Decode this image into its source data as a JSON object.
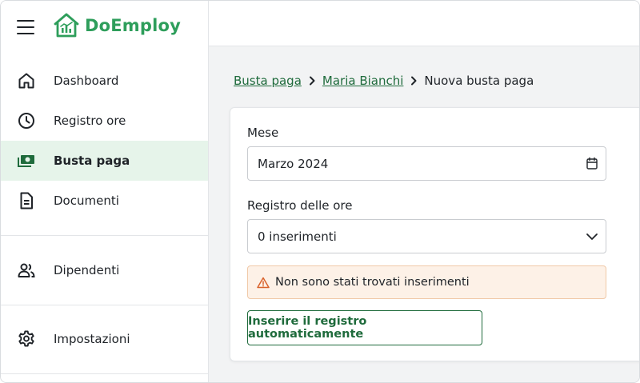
{
  "app": {
    "name": "DoEmploy",
    "brand_color": "#2e9e5b"
  },
  "sidebar": {
    "items": [
      {
        "label": "Dashboard",
        "icon": "home-icon"
      },
      {
        "label": "Registro ore",
        "icon": "clock-icon"
      },
      {
        "label": "Busta paga",
        "icon": "money-icon",
        "active": true
      },
      {
        "label": "Documenti",
        "icon": "document-icon"
      },
      {
        "label": "Dipendenti",
        "icon": "users-icon"
      },
      {
        "label": "Impostazioni",
        "icon": "gear-icon"
      }
    ]
  },
  "breadcrumb": {
    "items": [
      "Busta paga",
      "Maria Bianchi"
    ],
    "current": "Nuova busta paga"
  },
  "form": {
    "month_label": "Mese",
    "month_value": "Marzo 2024",
    "hours_label": "Registro delle ore",
    "hours_value": "0 inserimenti",
    "alert_text": "Non sono stati trovati inserimenti",
    "auto_button_label": "Inserire il registro automaticamente"
  },
  "colors": {
    "accent": "#1f6b3c",
    "active_nav_bg": "#e6f4ea",
    "alert_bg": "#fdf1e7",
    "warning": "#d9622b"
  }
}
